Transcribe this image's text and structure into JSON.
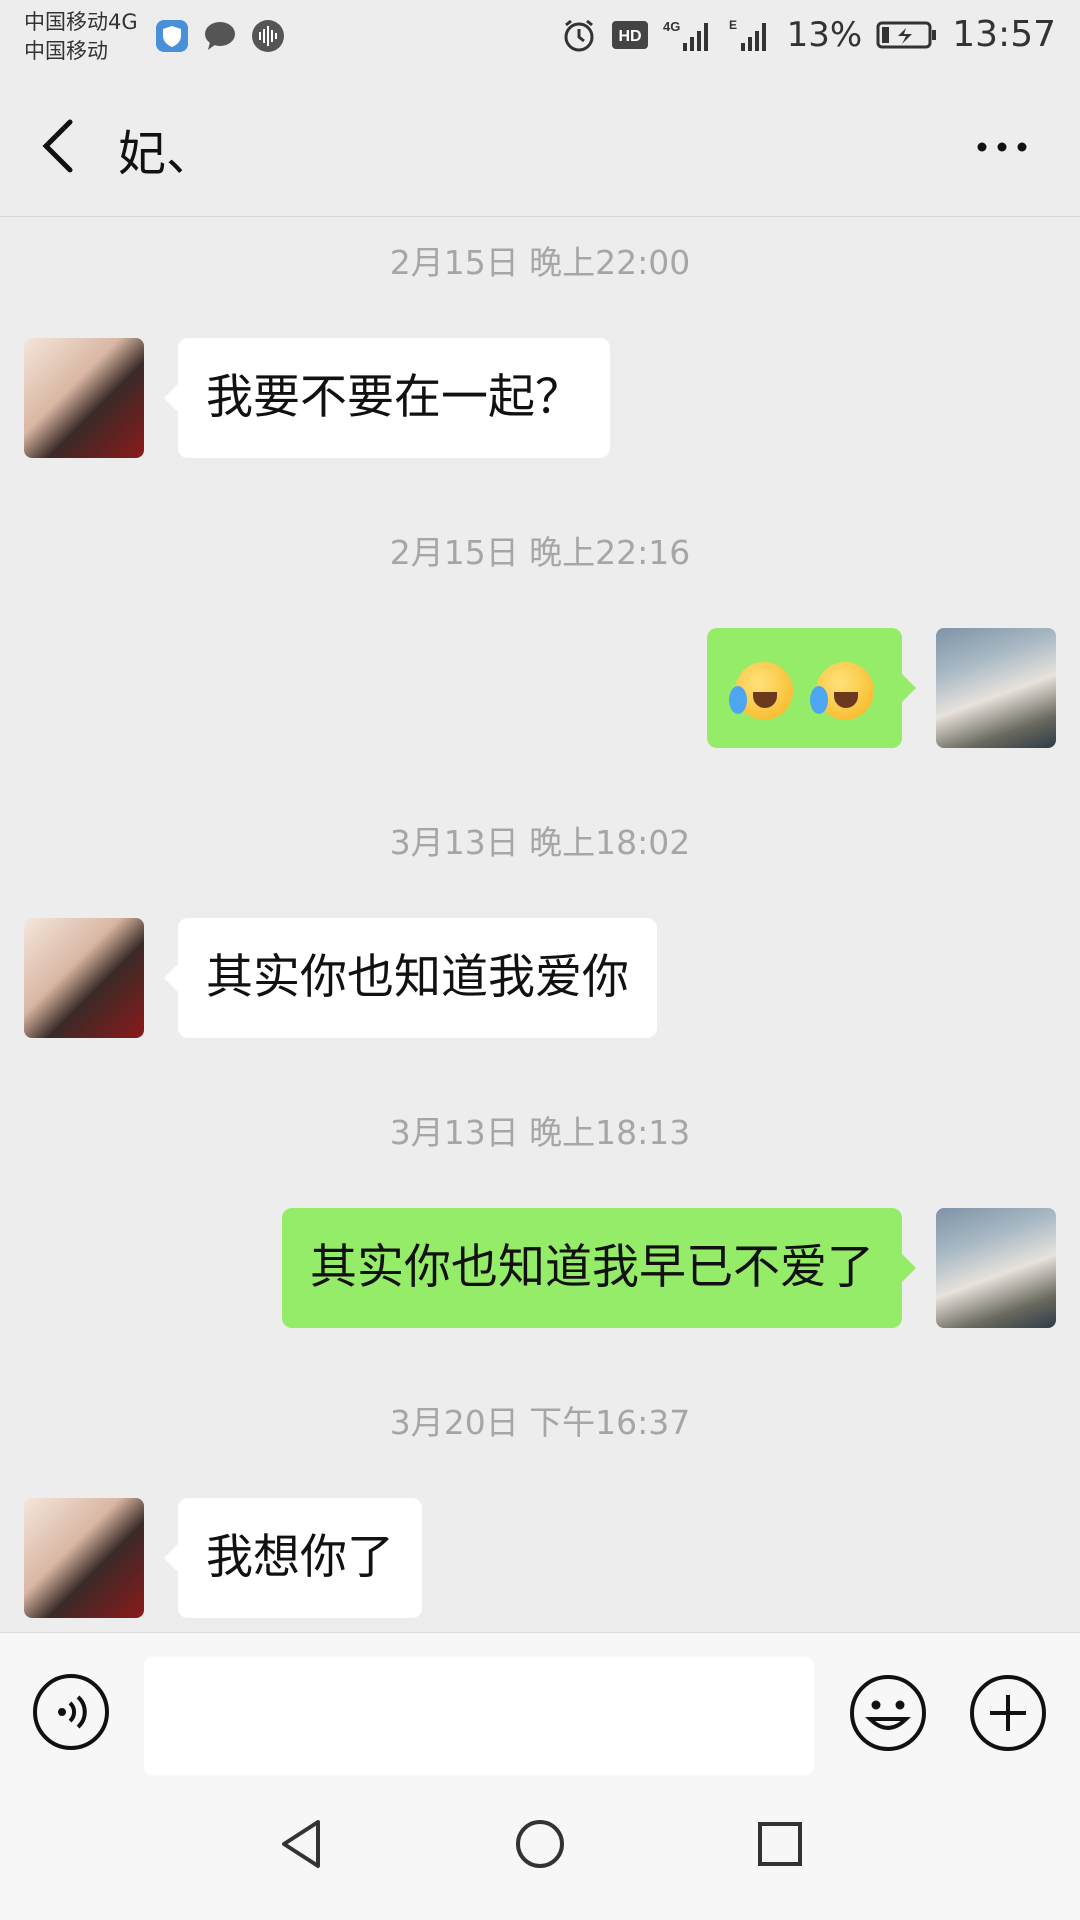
{
  "status_bar": {
    "carrier1": "中国移动4G",
    "carrier2": "中国移动",
    "battery": "13%",
    "time": "13:57",
    "hd_label": "HD",
    "net_label": "4G",
    "e_label": "E"
  },
  "header": {
    "title": "妃、"
  },
  "messages": [
    {
      "timestamp": "2月15日 晚上22:00",
      "side": "left",
      "text": "我要不要在一起？"
    },
    {
      "timestamp": "2月15日 晚上22:16",
      "side": "right",
      "content": "emoji x2"
    },
    {
      "timestamp": "3月13日 晚上18:02",
      "side": "left",
      "text": "其实你也知道我爱你"
    },
    {
      "timestamp": "3月13日 晚上18:13",
      "side": "right",
      "text": "其实你也知道我早已不爱了"
    },
    {
      "timestamp": "3月20日 下午16:37",
      "side": "left",
      "text": "我想你了"
    }
  ],
  "input": {
    "value": "",
    "placeholder": ""
  },
  "icons": {
    "back": "back-arrow-icon",
    "more": "more-icon",
    "voice": "voice-icon",
    "emoji": "emoji-icon",
    "plus": "plus-icon",
    "nav_back": "nav-back-icon",
    "nav_home": "nav-home-icon",
    "nav_recent": "nav-recent-icon"
  },
  "colors": {
    "background": "#ededed",
    "outgoing_bubble": "#95ec69",
    "incoming_bubble": "#ffffff",
    "timestamp": "#a6a6a6"
  }
}
